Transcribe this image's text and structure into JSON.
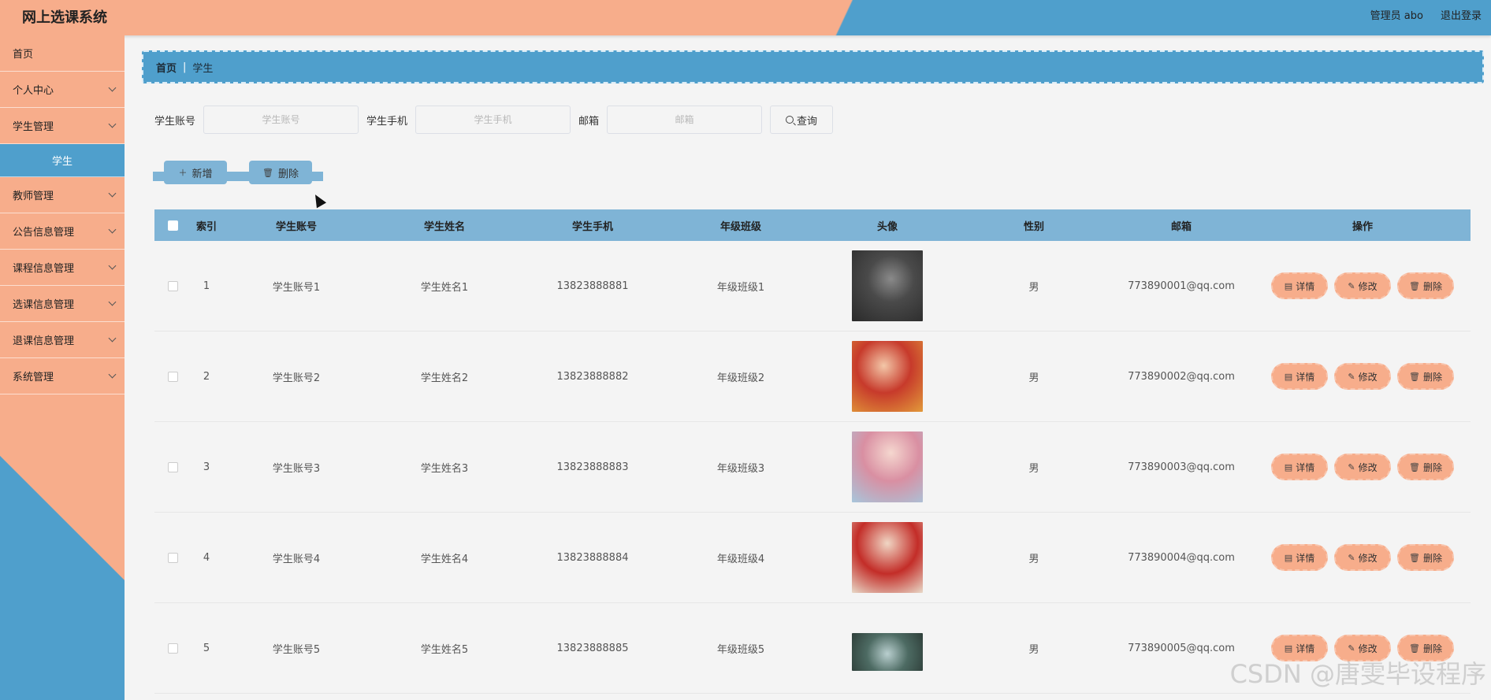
{
  "app": {
    "title": "网上选课系统",
    "user": "管理员 abo",
    "logout": "退出登录"
  },
  "sidebar": {
    "items": [
      {
        "label": "首页"
      },
      {
        "label": "个人中心"
      },
      {
        "label": "学生管理"
      },
      {
        "label": "学生"
      },
      {
        "label": "教师管理"
      },
      {
        "label": "公告信息管理"
      },
      {
        "label": "课程信息管理"
      },
      {
        "label": "选课信息管理"
      },
      {
        "label": "退课信息管理"
      },
      {
        "label": "系统管理"
      }
    ]
  },
  "breadcrumb": {
    "home": "首页",
    "separator": "|",
    "current": "学生"
  },
  "search": {
    "account_label": "学生账号",
    "account_placeholder": "学生账号",
    "phone_label": "学生手机",
    "phone_placeholder": "学生手机",
    "email_label": "邮箱",
    "email_placeholder": "邮箱",
    "query_label": "查询"
  },
  "actions": {
    "add_label": "新增",
    "delete_label": "删除"
  },
  "table": {
    "headers": {
      "index": "索引",
      "account": "学生账号",
      "name": "学生姓名",
      "phone": "学生手机",
      "grade": "年级班级",
      "avatar": "头像",
      "gender": "性别",
      "email": "邮箱",
      "ops": "操作"
    },
    "ops": {
      "detail": "详情",
      "edit": "修改",
      "delete": "删除"
    },
    "rows": [
      {
        "index": "1",
        "account": "学生账号1",
        "name": "学生姓名1",
        "phone": "13823888881",
        "grade": "年级班级1",
        "gender": "男",
        "email": "773890001@qq.com"
      },
      {
        "index": "2",
        "account": "学生账号2",
        "name": "学生姓名2",
        "phone": "13823888882",
        "grade": "年级班级2",
        "gender": "男",
        "email": "773890002@qq.com"
      },
      {
        "index": "3",
        "account": "学生账号3",
        "name": "学生姓名3",
        "phone": "13823888883",
        "grade": "年级班级3",
        "gender": "男",
        "email": "773890003@qq.com"
      },
      {
        "index": "4",
        "account": "学生账号4",
        "name": "学生姓名4",
        "phone": "13823888884",
        "grade": "年级班级4",
        "gender": "男",
        "email": "773890004@qq.com"
      },
      {
        "index": "5",
        "account": "学生账号5",
        "name": "学生姓名5",
        "phone": "13823888885",
        "grade": "年级班级5",
        "gender": "男",
        "email": "773890005@qq.com"
      }
    ]
  },
  "watermark": "CSDN @唐雯毕设程序",
  "colors": {
    "accent_orange": "#f7ad8b",
    "accent_blue": "#4f9fcc",
    "header_blue": "#7fb4d6"
  }
}
